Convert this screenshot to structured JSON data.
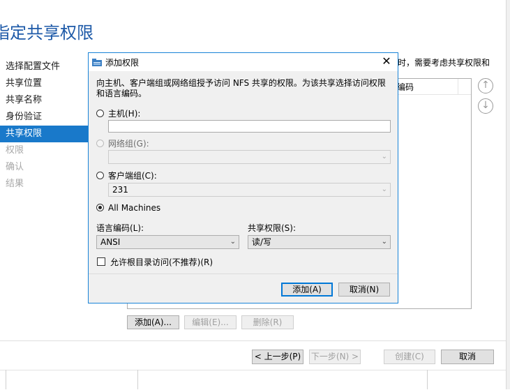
{
  "wizard": {
    "title": "指定共享权限",
    "nav": [
      {
        "label": "选择配置文件",
        "state": "normal"
      },
      {
        "label": "共享位置",
        "state": "normal"
      },
      {
        "label": "共享名称",
        "state": "normal"
      },
      {
        "label": "身份验证",
        "state": "normal"
      },
      {
        "label": "共享权限",
        "state": "active"
      },
      {
        "label": "权限",
        "state": "disabled"
      },
      {
        "label": "确认",
        "state": "disabled"
      },
      {
        "label": "结果",
        "state": "disabled"
      }
    ],
    "description_fragment": "时，需要考虑共享权限和",
    "table_column_fragment": "编码",
    "list_buttons": {
      "add": "添加(A)...",
      "edit": "编辑(E)...",
      "remove": "删除(R)"
    },
    "footer_buttons": {
      "prev": "< 上一步(P)",
      "next": "下一步(N) >",
      "create": "创建(C)",
      "cancel": "取消"
    }
  },
  "dialog": {
    "title": "添加权限",
    "close_glyph": "✕",
    "description": "向主机、客户端组或网络组授予访问 NFS 共享的权限。为该共享选择访问权限和语言编码。",
    "host_label": "主机(H):",
    "host_value": "",
    "netgroup_label": "网络组(G):",
    "netgroup_value": "",
    "clientgroup_label": "客户端组(C):",
    "clientgroup_value": "231",
    "allmachines_label": "All Machines",
    "selected_option": "All Machines",
    "encoding_label": "语言编码(L):",
    "encoding_value": "ANSI",
    "permission_label": "共享权限(S):",
    "permission_value": "读/写",
    "root_access_label": "允许根目录访问(不推荐)(R)",
    "root_access_checked": false,
    "add_button": "添加(A)",
    "cancel_button": "取消(N)"
  },
  "colors": {
    "accent": "#1979ca",
    "dialog_border": "#1883d7",
    "title_blue": "#1e5aa8"
  },
  "icons": {
    "dialog": "share-folder-icon",
    "up": "arrow-up-icon",
    "down": "arrow-down-icon",
    "dropdown": "chevron-down-icon"
  }
}
